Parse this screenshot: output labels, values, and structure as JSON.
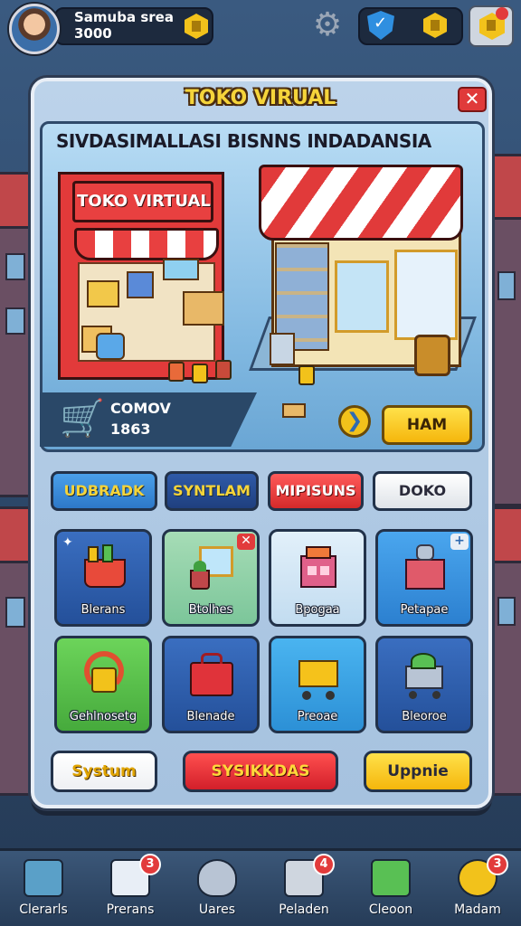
{
  "profile": {
    "name": "Samuba srea",
    "coins": "3000"
  },
  "panel": {
    "title": "TOKO VIRUAL",
    "close_label": "✕"
  },
  "hero": {
    "title": "SIVDASIMALLASI BISNNS INDADANSIA",
    "sign_text": "TOKO VIRTUAL",
    "stats_label": "COMOV",
    "stats_value": "1863",
    "arrow_label": "❯",
    "action_label": "HAM"
  },
  "tabs": [
    {
      "label": "UDBRADK"
    },
    {
      "label": "SYNTLAM"
    },
    {
      "label": "MIPISUNS"
    },
    {
      "label": "DOKO"
    }
  ],
  "tiles": [
    {
      "label": "Blerans",
      "icon": "shopping-basket-icon",
      "color": "#2c5aa0"
    },
    {
      "label": "Btolhes",
      "icon": "picture-frame-icon",
      "color": "#8fd0a8"
    },
    {
      "label": "Bpogaa",
      "icon": "building-icon",
      "color": "#cfe6f6"
    },
    {
      "label": "Petapae",
      "icon": "box-icon",
      "color": "#3a8ae0"
    },
    {
      "label": "Gehlnosetg",
      "icon": "headphones-icon",
      "color": "#59c054"
    },
    {
      "label": "Blenade",
      "icon": "red-case-icon",
      "color": "#2f5aa0"
    },
    {
      "label": "Preoae",
      "icon": "yellow-cart-icon",
      "color": "#3aa2e6"
    },
    {
      "label": "Bleoroe",
      "icon": "grocery-cart-icon",
      "color": "#2f5aa0"
    }
  ],
  "bottom_buttons": [
    {
      "label": "Systum"
    },
    {
      "label": "SYSIKKDAS"
    },
    {
      "label": "Uppnie"
    }
  ],
  "nav": [
    {
      "label": "Clerarls",
      "badge": ""
    },
    {
      "label": "Prerans",
      "badge": "3"
    },
    {
      "label": "Uares",
      "badge": ""
    },
    {
      "label": "Peladen",
      "badge": "4"
    },
    {
      "label": "Cleoon",
      "badge": ""
    },
    {
      "label": "Madam",
      "badge": "3"
    }
  ]
}
